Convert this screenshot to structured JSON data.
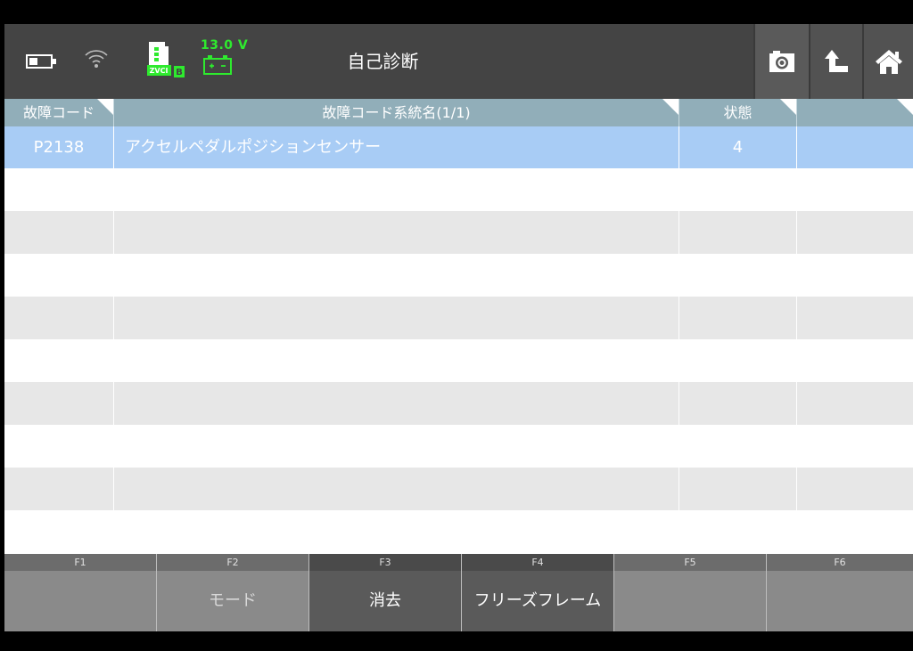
{
  "header": {
    "title": "自己診断",
    "voltage": "13.0 V",
    "vci_label": "ZVCI",
    "vci_badge": "B",
    "icons": [
      "battery-icon",
      "wifi-icon",
      "vci-device-icon",
      "car-battery-icon",
      "camera-icon",
      "up-arrow-icon",
      "home-icon"
    ]
  },
  "table": {
    "columns": [
      "故障コード",
      "故障コード系統名(1/1)",
      "状態",
      ""
    ],
    "rows": [
      {
        "code": "P2138",
        "name": "アクセルペダルポジションセンサー",
        "state": "4",
        "extra": ""
      }
    ],
    "selected_color": "#a8ccf5"
  },
  "fkeys": [
    {
      "key": "F1",
      "label": ""
    },
    {
      "key": "F2",
      "label": "モード"
    },
    {
      "key": "F3",
      "label": "消去"
    },
    {
      "key": "F4",
      "label": "フリーズフレーム"
    },
    {
      "key": "F5",
      "label": ""
    },
    {
      "key": "F6",
      "label": ""
    }
  ],
  "colors": {
    "topbar": "#444444",
    "header": "#91aeb9",
    "voltage": "#2eea2e"
  }
}
